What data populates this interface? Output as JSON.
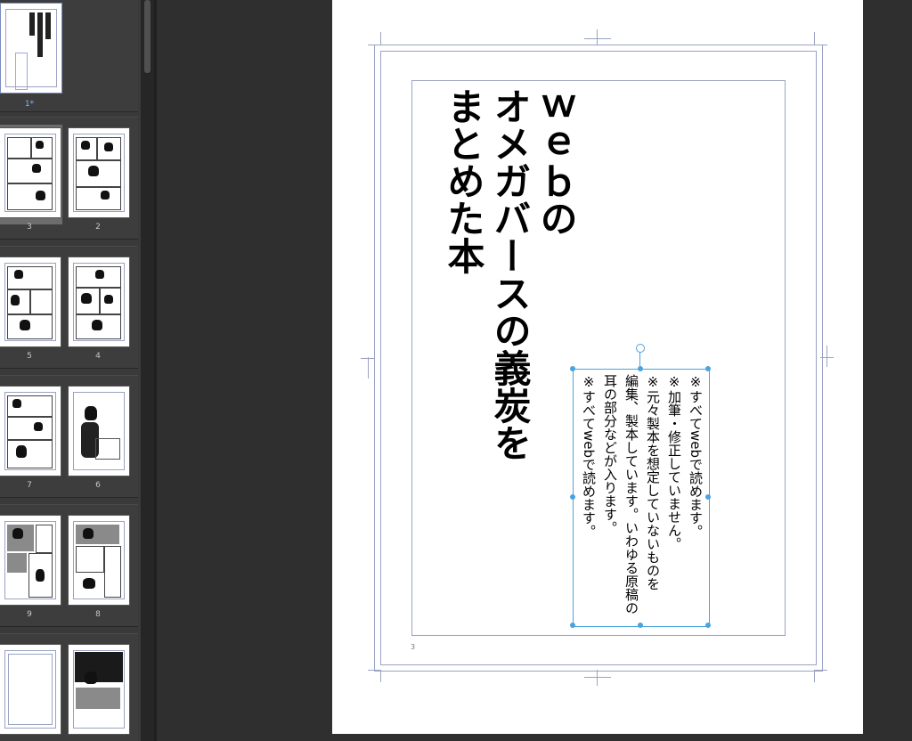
{
  "pages_panel": {
    "spreads": [
      {
        "pages": [
          {
            "label": "1*",
            "current": true
          }
        ]
      },
      {
        "pages": [
          {
            "label": "3",
            "selected": true
          },
          {
            "label": "2"
          }
        ]
      },
      {
        "pages": [
          {
            "label": "5"
          },
          {
            "label": "4"
          }
        ]
      },
      {
        "pages": [
          {
            "label": "7"
          },
          {
            "label": "6"
          }
        ]
      },
      {
        "pages": [
          {
            "label": "9"
          },
          {
            "label": "8"
          }
        ]
      },
      {
        "pages": [
          {
            "label": ""
          },
          {
            "label": ""
          }
        ]
      }
    ]
  },
  "page": {
    "title": "ｗｅｂの\nオメガバースの義炭を\nまとめた本",
    "notes": "※すべてwebで読めます。\n※加筆・修正していません。\n※元々製本を想定していないものを\n編集、製本しています。いわゆる原稿の\n耳の部分などが入ります。\n※すべてwebで読めます。",
    "folio": "3"
  },
  "colors": {
    "guide": "#9aa3c2",
    "selection": "#4aa3df",
    "current_page_label": "#7fb3ff"
  }
}
